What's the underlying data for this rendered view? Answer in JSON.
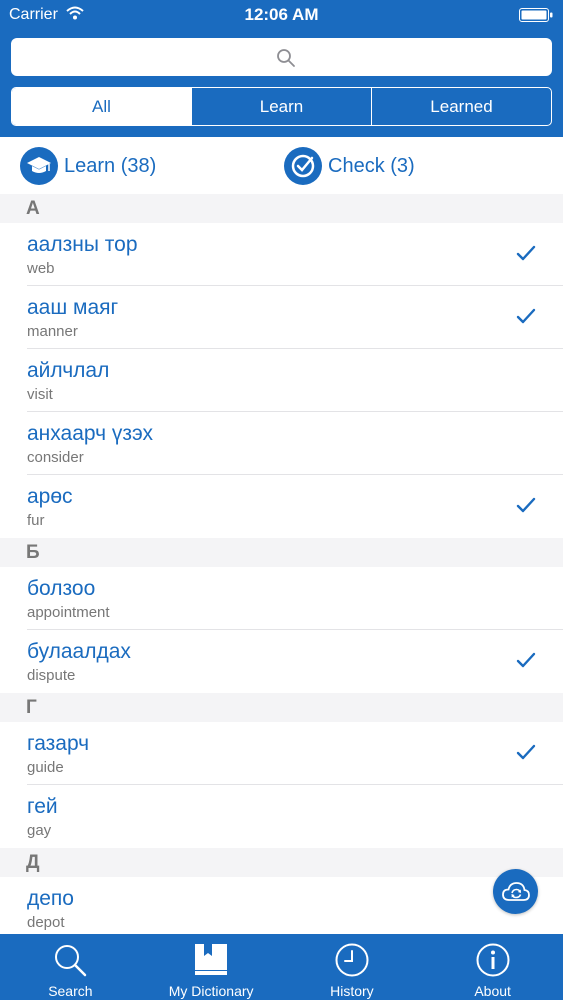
{
  "status": {
    "carrier": "Carrier",
    "time": "12:06 AM"
  },
  "search": {
    "placeholder": ""
  },
  "segments": [
    {
      "label": "All",
      "active": true
    },
    {
      "label": "Learn",
      "active": false
    },
    {
      "label": "Learned",
      "active": false
    }
  ],
  "actions": {
    "learn_label": "Learn (38)",
    "check_label": "Check (3)"
  },
  "sections": [
    {
      "letter": "A",
      "rows": [
        {
          "word": "аалзны тор",
          "translation": "web",
          "checked": true
        },
        {
          "word": "ааш маяг",
          "translation": "manner",
          "checked": true
        },
        {
          "word": "айлчлал",
          "translation": "visit",
          "checked": false
        },
        {
          "word": "анхаарч үзэх",
          "translation": "consider",
          "checked": false
        },
        {
          "word": "арөс",
          "translation": "fur",
          "checked": true
        }
      ]
    },
    {
      "letter": "Б",
      "rows": [
        {
          "word": "болзоо",
          "translation": "appointment",
          "checked": false
        },
        {
          "word": "булаалдах",
          "translation": "dispute",
          "checked": true
        }
      ]
    },
    {
      "letter": "Г",
      "rows": [
        {
          "word": "газарч",
          "translation": "guide",
          "checked": true
        },
        {
          "word": "гей",
          "translation": "gay",
          "checked": false
        }
      ]
    },
    {
      "letter": "Д",
      "rows": [
        {
          "word": "депо",
          "translation": "depot",
          "checked": false
        }
      ]
    }
  ],
  "tabs": [
    {
      "label": "Search",
      "icon": "search-icon"
    },
    {
      "label": "My Dictionary",
      "icon": "book-icon"
    },
    {
      "label": "History",
      "icon": "clock-icon"
    },
    {
      "label": "About",
      "icon": "info-icon"
    }
  ],
  "colors": {
    "accent": "#1a6bbf",
    "section_bg": "#f4f4f6",
    "subtext": "#777777"
  }
}
